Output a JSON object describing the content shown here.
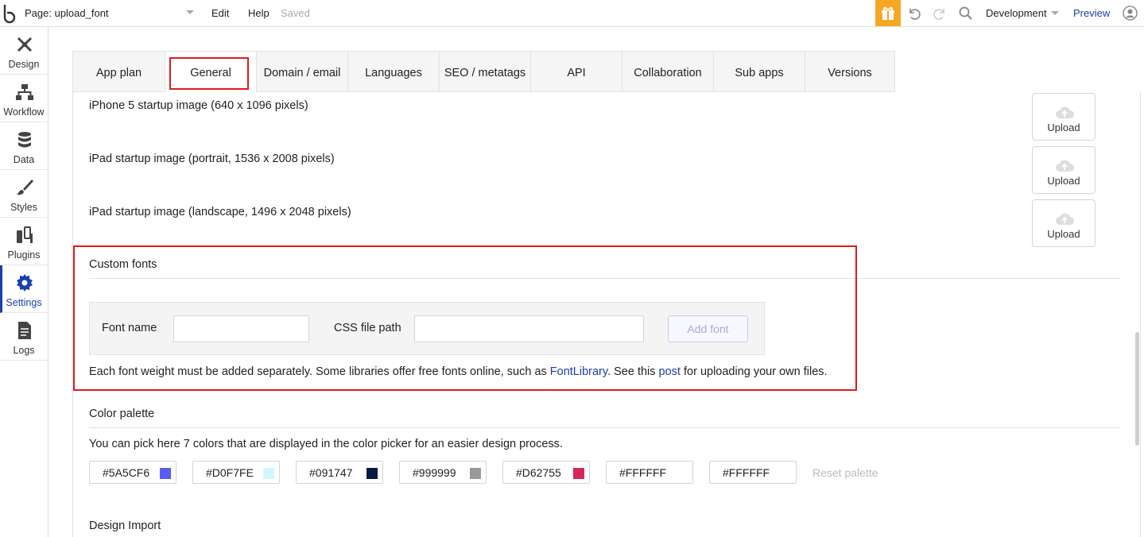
{
  "topbar": {
    "page_label": "Page: upload_font",
    "menu_edit": "Edit",
    "menu_help": "Help",
    "save_status": "Saved",
    "environment": "Development",
    "preview": "Preview"
  },
  "sidebar": {
    "items": [
      {
        "label": "Design",
        "icon": "design-icon"
      },
      {
        "label": "Workflow",
        "icon": "workflow-icon"
      },
      {
        "label": "Data",
        "icon": "database-icon"
      },
      {
        "label": "Styles",
        "icon": "brush-icon"
      },
      {
        "label": "Plugins",
        "icon": "plugins-icon"
      },
      {
        "label": "Settings",
        "icon": "gear-icon",
        "active": true
      },
      {
        "label": "Logs",
        "icon": "document-icon"
      }
    ]
  },
  "tabs": [
    {
      "label": "App plan"
    },
    {
      "label": "General",
      "active": true
    },
    {
      "label": "Domain / email"
    },
    {
      "label": "Languages"
    },
    {
      "label": "SEO / metatags"
    },
    {
      "label": "API"
    },
    {
      "label": "Collaboration"
    },
    {
      "label": "Sub apps"
    },
    {
      "label": "Versions"
    }
  ],
  "startup_images": [
    {
      "label": "iPhone 5 startup image (640 x 1096 pixels)",
      "button": "Upload"
    },
    {
      "label": "iPad startup image (portrait, 1536 x 2008 pixels)",
      "button": "Upload"
    },
    {
      "label": "iPad startup image (landscape, 1496 x 2048 pixels)",
      "button": "Upload"
    }
  ],
  "custom_fonts": {
    "title": "Custom fonts",
    "font_name_label": "Font name",
    "font_name_value": "",
    "css_path_label": "CSS file path",
    "css_path_value": "",
    "add_button": "Add font",
    "note_prefix": "Each font weight must be added separately. Some libraries offer free fonts online, such as ",
    "note_link1": "FontLibrary",
    "note_mid": ". See this ",
    "note_link2": "post",
    "note_suffix": " for uploading your own files."
  },
  "color_palette": {
    "title": "Color palette",
    "description": "You can pick here 7 colors that are displayed in the color picker for an easier design process.",
    "colors": [
      {
        "hex": "#5A5CF6",
        "color": "#5A5CF6"
      },
      {
        "hex": "#D0F7FE",
        "color": "#D0F7FE"
      },
      {
        "hex": "#091747",
        "color": "#091747"
      },
      {
        "hex": "#999999",
        "color": "#999999"
      },
      {
        "hex": "#D62755",
        "color": "#D62755"
      },
      {
        "hex": "#FFFFFF",
        "color": "#FFFFFF"
      },
      {
        "hex": "#FFFFFF",
        "color": "#FFFFFF"
      }
    ],
    "reset": "Reset palette"
  },
  "design_import": {
    "title": "Design Import"
  },
  "colors": {
    "accent": "#1a3fb0",
    "highlight": "#e01b1b",
    "gift": "#f5a623"
  }
}
